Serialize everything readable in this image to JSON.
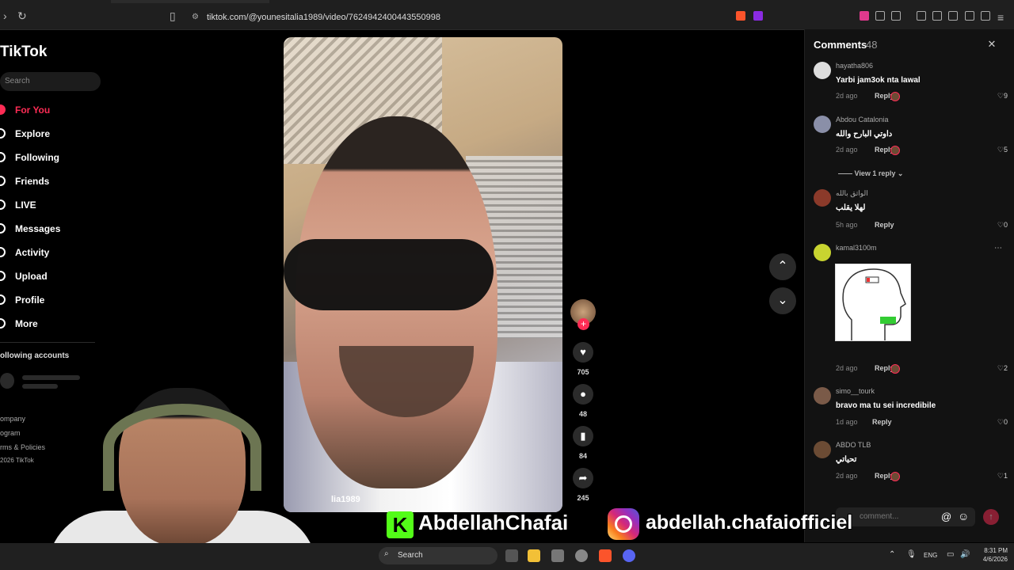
{
  "browser": {
    "url": "tiktok.com/@younesitalia1989/video/7624942400443550998"
  },
  "sidebar": {
    "logo": "TikTok",
    "search_placeholder": "Search",
    "items": [
      {
        "label": "For You",
        "icon": "home-icon"
      },
      {
        "label": "Explore",
        "icon": "compass-icon"
      },
      {
        "label": "Following",
        "icon": "following-icon"
      },
      {
        "label": "Friends",
        "icon": "friends-icon"
      },
      {
        "label": "LIVE",
        "icon": "live-icon"
      },
      {
        "label": "Messages",
        "icon": "messages-icon"
      },
      {
        "label": "Activity",
        "icon": "activity-icon"
      },
      {
        "label": "Upload",
        "icon": "upload-icon"
      },
      {
        "label": "Profile",
        "icon": "profile-icon"
      },
      {
        "label": "More",
        "icon": "more-icon"
      }
    ],
    "following_header": "ollowing accounts",
    "footer": [
      "ompany",
      "ogram",
      "rms & Policies",
      "2026 TikTok"
    ]
  },
  "video": {
    "author": "lia1989",
    "caption_fragment": "tiktok"
  },
  "actions": {
    "likes": "705",
    "comments": "48",
    "saves": "84",
    "shares": "245"
  },
  "comments_panel": {
    "title": "Comments",
    "count": "48",
    "reply_label": "Reply",
    "view_replies": "View 1 reply",
    "input_placeholder": "comment...",
    "items": [
      {
        "user": "hayatha806",
        "text": "Yarbi jam3ok nta lawal",
        "time": "2d ago",
        "likes": "9",
        "avatar": "#dddddd"
      },
      {
        "user": "Abdou Catalonia",
        "text": "داوتي البارح والله",
        "time": "2d ago",
        "likes": "5",
        "avatar": "#8a8fa8"
      },
      {
        "user": "الواثق بالله",
        "text": "لهلا يقلب",
        "time": "5h ago",
        "likes": "0",
        "avatar": "#8b3a2a"
      },
      {
        "user": "kamal3100m",
        "text": "",
        "time": "2d ago",
        "likes": "2",
        "avatar": "#c8d430"
      },
      {
        "user": "simo__tourk",
        "text": "bravo ma tu sei incredibile",
        "time": "1d ago",
        "likes": "0",
        "avatar": "#7a5a48"
      },
      {
        "user": "ABDO TLB",
        "text": "تحياتي",
        "time": "2d ago",
        "likes": "1",
        "avatar": "#6b4b34"
      }
    ]
  },
  "overlay": {
    "kick_name": "AbdellahChafai",
    "instagram_name": "abdellah.chafaiofficiel"
  },
  "taskbar": {
    "search": "Search",
    "lang": "ENG",
    "time": "8:31 PM",
    "date": "4/6/2026"
  },
  "colors": {
    "accent": "#fe2c55",
    "kick": "#53fc18"
  }
}
